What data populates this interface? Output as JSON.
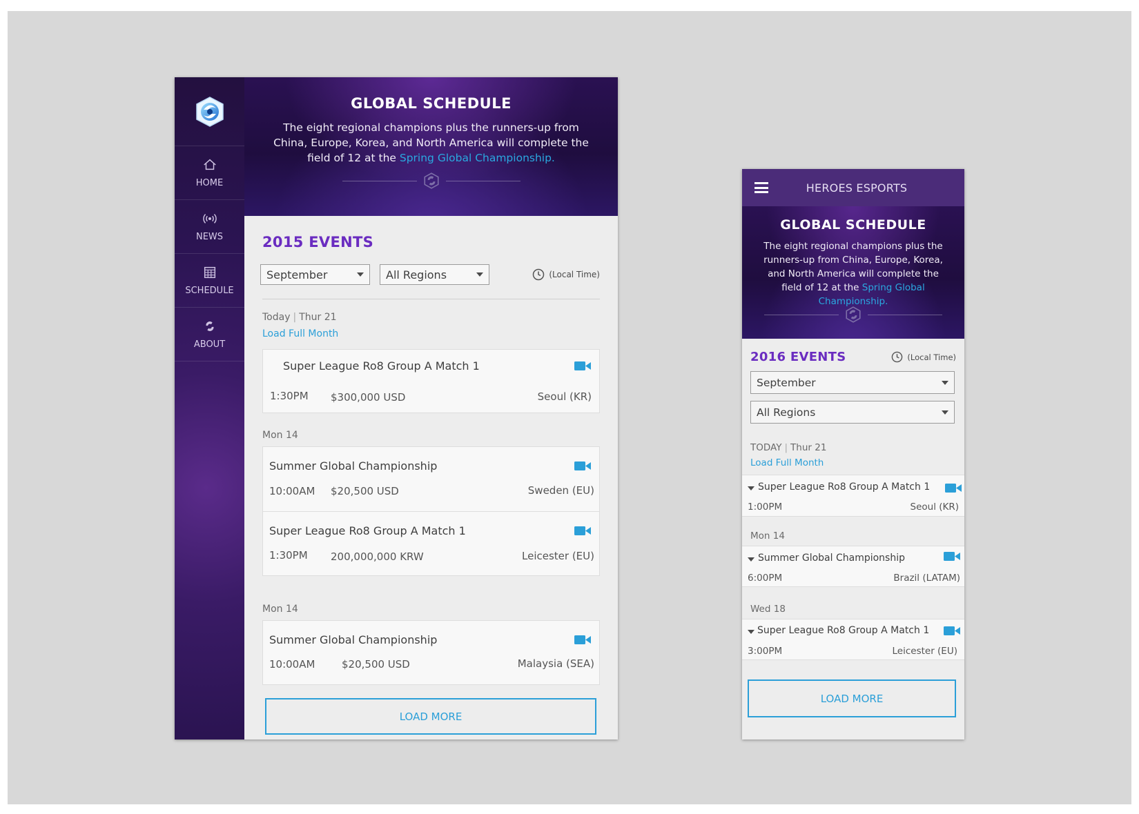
{
  "desktop": {
    "nav": [
      {
        "label": "HOME",
        "icon": "home-icon"
      },
      {
        "label": "NEWS",
        "icon": "broadcast-icon"
      },
      {
        "label": "SCHEDULE",
        "icon": "calendar-icon"
      },
      {
        "label": "ABOUT",
        "icon": "heroes-logo-icon"
      }
    ],
    "hero": {
      "title": "GLOBAL SCHEDULE",
      "body": "The eight regional champions plus the runners-up from China, Europe, Korea, and North America will complete the field of 12 at the ",
      "link": "Spring Global Championship."
    },
    "events_title": "2015 EVENTS",
    "filters": {
      "month": "September",
      "region": "All Regions",
      "local_time": "(Local Time)"
    },
    "today": {
      "label": "Today",
      "date": "Thur 21",
      "load_full_month": "Load Full Month"
    },
    "groups": [
      {
        "label": "",
        "events": [
          {
            "name": "Super League Ro8 Group A Match 1",
            "time": "1:30PM",
            "prize": "$300,000 USD",
            "location": "Seoul (KR)"
          }
        ]
      },
      {
        "label": "Mon 14",
        "events": [
          {
            "name": "Summer Global Championship",
            "time": "10:00AM",
            "prize": "$20,500 USD",
            "location": "Sweden (EU)"
          },
          {
            "name": "Super League Ro8 Group A Match 1",
            "time": "1:30PM",
            "prize": "200,000,000 KRW",
            "location": "Leicester (EU)"
          }
        ]
      },
      {
        "label": "Mon 14",
        "events": [
          {
            "name": "Summer Global Championship",
            "time": "10:00AM",
            "prize": "$20,500 USD",
            "location": "Malaysia (SEA)"
          }
        ]
      }
    ],
    "load_more": "LOAD MORE"
  },
  "mobile": {
    "app_title": "HEROES ESPORTS",
    "hero": {
      "title": "GLOBAL SCHEDULE",
      "body": "The eight regional champions plus the runners-up from China, Europe, Korea, and North America will complete the field of 12 at the ",
      "link": "Spring Global Championship."
    },
    "events_title": "2016 EVENTS",
    "local_time": "(Local Time)",
    "filters": {
      "month": "September",
      "region": "All Regions"
    },
    "today": {
      "label": "TODAY",
      "date": "Thur 21",
      "load_full_month": "Load Full Month"
    },
    "events": [
      {
        "day": "",
        "name": "Super League Ro8 Group A Match 1",
        "time": "1:00PM",
        "location": "Seoul (KR)"
      },
      {
        "day": "Mon 14",
        "name": "Summer Global Championship",
        "time": "6:00PM",
        "location": "Brazil (LATAM)"
      },
      {
        "day": "Wed 18",
        "name": "Super League Ro8 Group A Match 1",
        "time": "3:00PM",
        "location": "Leicester (EU)"
      }
    ],
    "load_more": "LOAD MORE"
  },
  "colors": {
    "accent_blue": "#2b9fd8",
    "title_purple": "#6a2cc0",
    "nav_purple": "#2b1452",
    "header_purple": "#4b2c79"
  }
}
